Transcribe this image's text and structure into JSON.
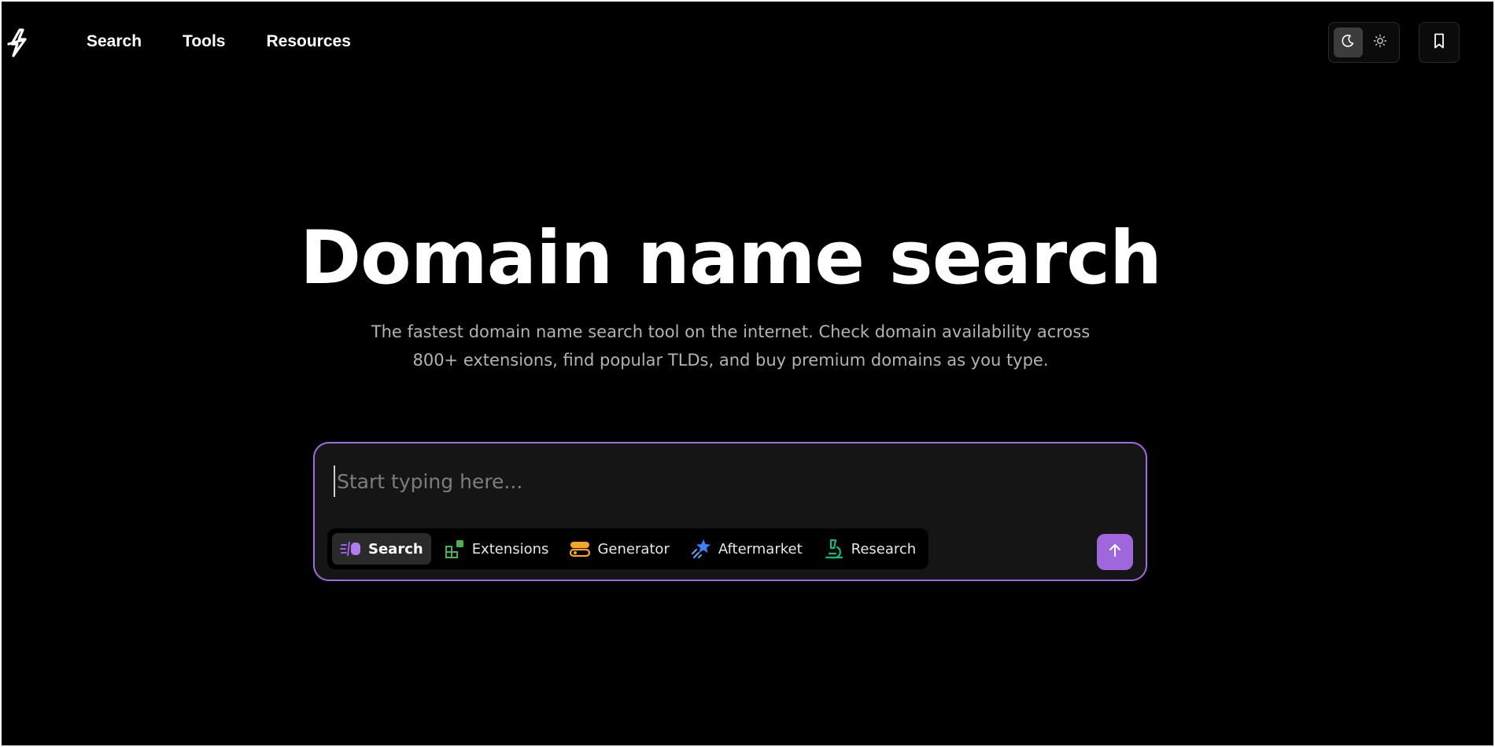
{
  "nav": {
    "items": [
      {
        "label": "Search"
      },
      {
        "label": "Tools"
      },
      {
        "label": "Resources"
      }
    ]
  },
  "header": {
    "logo_icon": "bolt-icon",
    "theme_dark_icon": "moon-icon",
    "theme_light_icon": "sun-icon",
    "bookmark_icon": "bookmark-icon"
  },
  "hero": {
    "title": "Domain name search",
    "subtitle": "The fastest domain name search tool on the internet. Check domain availability across 800+ extensions, find popular TLDs, and buy premium domains as you type."
  },
  "search": {
    "placeholder": "Start typing here...",
    "value": "",
    "modes": [
      {
        "label": "Search",
        "icon": "search-speed-icon",
        "color": "#9b5de5",
        "active": true
      },
      {
        "label": "Extensions",
        "icon": "extensions-icon",
        "color": "#4caf50",
        "active": false
      },
      {
        "label": "Generator",
        "icon": "generator-icon",
        "color": "#f5a623",
        "active": false
      },
      {
        "label": "Aftermarket",
        "icon": "aftermarket-icon",
        "color": "#3b82f6",
        "active": false
      },
      {
        "label": "Research",
        "icon": "microscope-icon",
        "color": "#10b981",
        "active": false
      }
    ],
    "submit_icon": "arrow-up-icon"
  },
  "colors": {
    "accent": "#a066db",
    "border_accent": "#a26ae0",
    "background": "#000000"
  }
}
